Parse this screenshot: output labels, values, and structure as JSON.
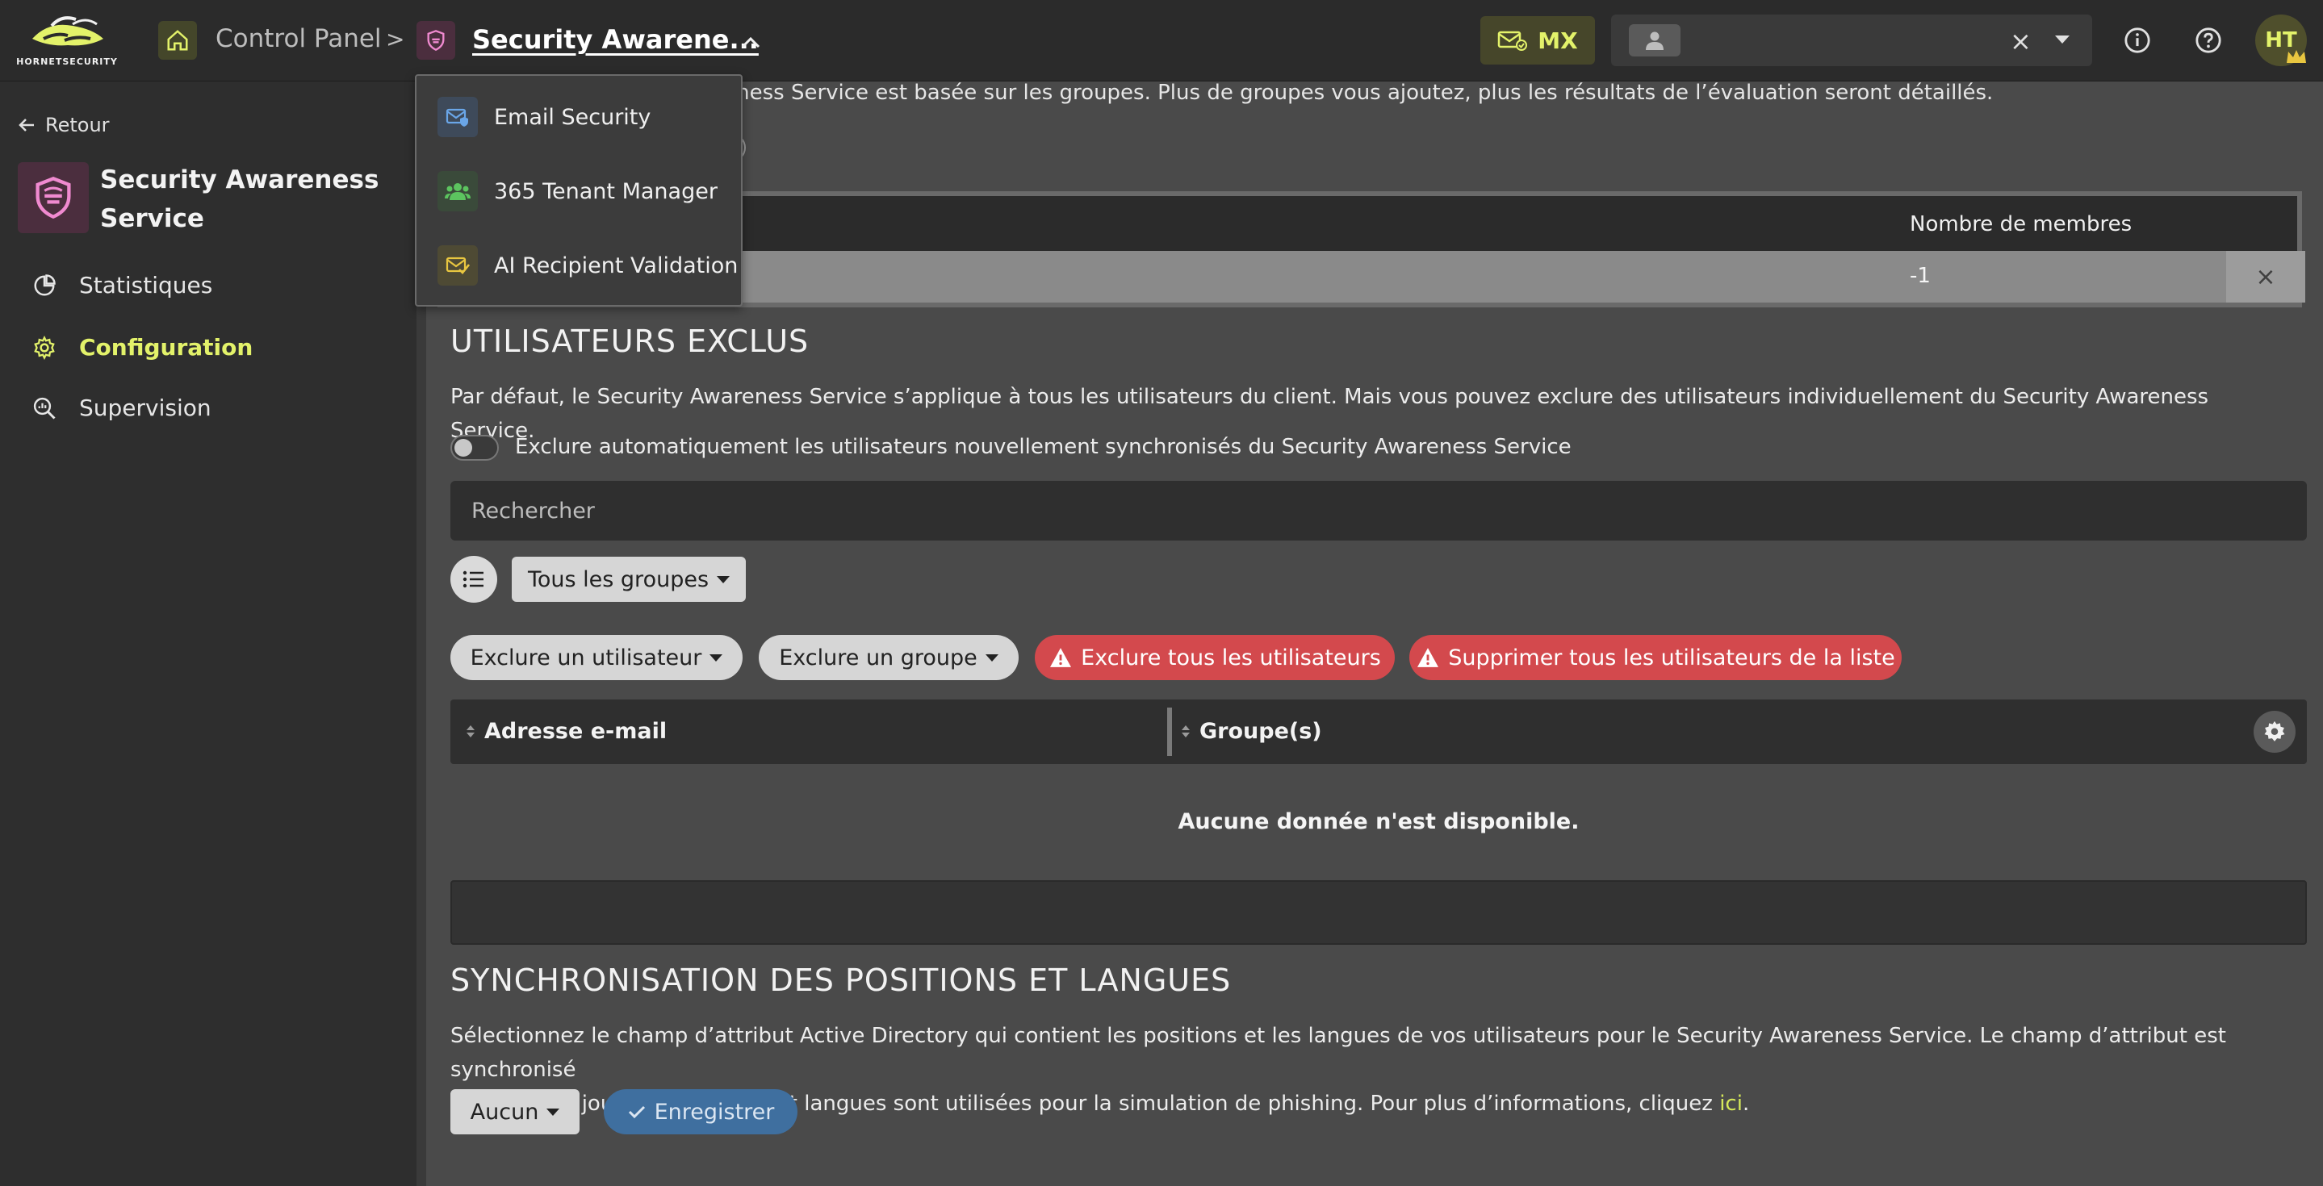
{
  "header": {
    "logo_text": "HORNETSECURITY",
    "breadcrumb_control_panel": "Control Panel",
    "breadcrumb_separator": ">",
    "breadcrumb_current": "Security Awarene...",
    "mx_label": "MX",
    "user_clear": "×",
    "avatar_initials": "HT"
  },
  "dropdown": {
    "items": [
      {
        "label": "Email Security",
        "icon": "email-shield-icon",
        "color": "#4a86c8"
      },
      {
        "label": "365 Tenant Manager",
        "icon": "users-icon",
        "color": "#4caf50"
      },
      {
        "label": "AI Recipient Validation",
        "icon": "email-check-icon",
        "color": "#e3c34a"
      }
    ]
  },
  "sidebar": {
    "back_label": "Retour",
    "service_name": "Security Awareness Service",
    "items": [
      {
        "label": "Statistiques",
        "icon": "pie-chart-icon",
        "active": false
      },
      {
        "label": "Configuration",
        "icon": "gear-icon",
        "active": true
      },
      {
        "label": "Supervision",
        "icon": "search-chart-icon",
        "active": false
      }
    ]
  },
  "main": {
    "top_text": "reness Service est basée sur les groupes. Plus de groupes vous ajoutez, plus les résultats de l’évaluation seront détaillés.",
    "groups_table": {
      "header_members": "Nombre de membres",
      "row_members": "-1",
      "delete": "×"
    },
    "excluded": {
      "title": "UTILISATEURS EXCLUS",
      "description": "Par défaut, le Security Awareness Service s’applique à tous les utilisateurs du client. Mais vous pouvez exclure des utilisateurs individuellement du Security Awareness Service.",
      "toggle_label": "Exclure automatiquement les utilisateurs nouvellement synchronisés du Security Awareness Service",
      "toggle_on": false,
      "search_placeholder": "Rechercher",
      "group_filter": "Tous les groupes",
      "btn_exclude_user": "Exclure un utilisateur",
      "btn_exclude_group": "Exclure un groupe",
      "btn_exclude_all": "Exclure tous les utilisateurs",
      "btn_remove_all": "Supprimer tous les utilisateurs de la liste",
      "col_email": "Adresse e-mail",
      "col_groups": "Groupe(s)",
      "no_data": "Aucune donnée n'est disponible."
    },
    "sync": {
      "title": "SYNCHRONISATION DES POSITIONS ET LANGUES",
      "description_1": "Sélectionnez le champ d’attribut Active Directory qui contient les positions et les langues de vos utilisateurs pour le Security Awareness Service. Le champ d’attribut est synchronisé",
      "description_2": "une fois par jour. Les positions et langues sont utilisées pour la simulation de phishing. Pour plus d’informations, cliquez ",
      "link_text": "ici",
      "description_end": ".",
      "select_value": "Aucun",
      "save_label": "Enregistrer"
    }
  },
  "colors": {
    "accent": "#e3f26a",
    "danger": "#d3494d",
    "primary": "#3f6f9f"
  }
}
